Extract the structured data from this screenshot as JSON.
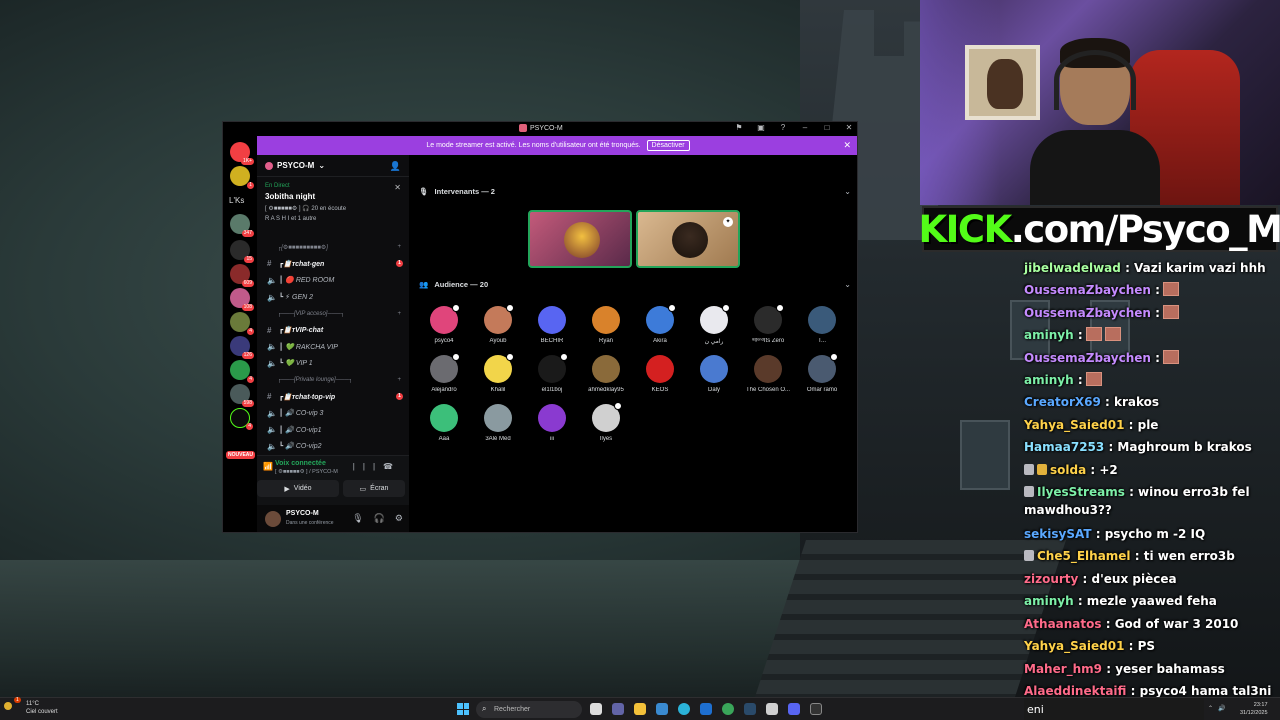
{
  "discord": {
    "title": "PSYCO-M",
    "streamer_banner": {
      "text": "Le mode streamer est activé. Les noms d'utilisateur ont été tronqués.",
      "button": "Désactiver"
    },
    "rail": {
      "lks_label": "L'Ks",
      "badges": [
        "1K+",
        "1",
        "347",
        "15",
        "609",
        "108",
        "4",
        "126",
        "4",
        "598",
        "4"
      ],
      "nouveau": "NOUVEAU"
    },
    "guild_name": "PSYCO-M",
    "live": {
      "tag": "En Direct",
      "title": "3obitha night",
      "listeners": "[ ⚙■■■■■⚙ ]  🎧 20 en écoute",
      "speakers": "R A S H I et 1 autre"
    },
    "channels": [
      {
        "kind": "cat",
        "label": "┌[⚙■■■■■■■■■⚙]"
      },
      {
        "kind": "text",
        "label": "┏📋ᴛchat-gen",
        "unread": "1"
      },
      {
        "kind": "voice",
        "label": "┃ 🔴 RED ROOM"
      },
      {
        "kind": "voice",
        "label": "┗ ⚡ GEN 2"
      },
      {
        "kind": "cat",
        "label": "┌───[VIP acceso]───┐"
      },
      {
        "kind": "text",
        "label": "┏📋ᴛVIP-chat"
      },
      {
        "kind": "voice",
        "label": "┃ 💚 RAKCHA VIP"
      },
      {
        "kind": "voice",
        "label": "┗ 💚 VIP 1"
      },
      {
        "kind": "cat",
        "label": "┌───[Private lounge]───┐"
      },
      {
        "kind": "text",
        "label": "┏📋ᴛchat-top-vip",
        "unread": "1"
      },
      {
        "kind": "voice",
        "label": "┃ 🔊 CO-vip 3"
      },
      {
        "kind": "voice",
        "label": "┃ 🔊 CO-vip1"
      },
      {
        "kind": "voice",
        "label": "┗ 🔊 CO-vip2"
      }
    ],
    "voice": {
      "status": "Voix connectée",
      "sub": "[ ⚙■■■■■⚙ ] / PSYCO-M",
      "video_btn": "Vidéo",
      "screen_btn": "Écran"
    },
    "user": {
      "name": "PSYCO-M",
      "status": "Dans une conférence"
    },
    "stage": {
      "speakers_header": "Intervenants — 2",
      "audience_header": "Audience — 20",
      "audience": [
        {
          "name": "psyco4",
          "color": "#e0457b"
        },
        {
          "name": "Ayoub",
          "color": "#c47a5a"
        },
        {
          "name": "BECHIR",
          "color": "#5865f2"
        },
        {
          "name": "Ryan",
          "color": "#d9822b"
        },
        {
          "name": "Akira",
          "color": "#3d7bd9"
        },
        {
          "name": "رامي ن",
          "color": "#e9e9ee"
        },
        {
          "name": "ˡᵉᵍᵉⁿᵈIts Zero",
          "color": "#2b2b2b"
        },
        {
          "name": "T...",
          "color": "#3a5a7a"
        },
        {
          "name": "Alejandro",
          "color": "#6b6b70"
        },
        {
          "name": "Khalil",
          "color": "#f2d54a"
        },
        {
          "name": "el1l1boj",
          "color": "#1a1a1a"
        },
        {
          "name": "ahmedklay95",
          "color": "#8a6a3a"
        },
        {
          "name": "KEOS",
          "color": "#d42020"
        },
        {
          "name": "Daly",
          "color": "#4a7ad0"
        },
        {
          "name": "The Chosen O...",
          "color": "#5a3a2a"
        },
        {
          "name": "Omar ramo",
          "color": "#4a5a70"
        },
        {
          "name": "Aaa",
          "color": "#3cbf7a"
        },
        {
          "name": "3Alé Med",
          "color": "#8a9aa0"
        },
        {
          "name": "iii",
          "color": "#8a3ad0"
        },
        {
          "name": "Ilyes",
          "color": "#d0d0d0"
        }
      ]
    }
  },
  "kick": {
    "logo": "KICK",
    "rest": ".com/Psyco_M"
  },
  "chat": [
    {
      "user": "jibelwadelwad",
      "color": "#a8ffa0",
      "text": ": Vazi karim vazi hhh"
    },
    {
      "user": "OussemaZbaychen",
      "color": "#c58bff",
      "text": ":",
      "emotes": 1
    },
    {
      "user": "OussemaZbaychen",
      "color": "#c58bff",
      "text": ":",
      "emotes": 1
    },
    {
      "user": "aminyh",
      "color": "#7df0a8",
      "text": ":",
      "emotes": 2
    },
    {
      "user": "OussemaZbaychen",
      "color": "#c58bff",
      "text": ":",
      "emotes": 1
    },
    {
      "user": "aminyh",
      "color": "#7df0a8",
      "text": ":",
      "emotes": 1
    },
    {
      "user": "CreatorX69",
      "color": "#5aa8ff",
      "text": ": krakos"
    },
    {
      "user": "Yahya_Saied01",
      "color": "#ffd24a",
      "text": ": ple"
    },
    {
      "user": "Hamaa7253",
      "color": "#8ae0ff",
      "text": ": Maghroum b krakos"
    },
    {
      "user": "solda",
      "color": "#ffd24a",
      "text": ": +2",
      "badges": [
        "silver",
        "gold"
      ]
    },
    {
      "user": "IlyesStreams",
      "color": "#7df0a8",
      "text": ": winou erro3b fel mawdhou3??",
      "badges": [
        "silver"
      ],
      "wrap": true
    },
    {
      "user": "sekisySAT",
      "color": "#5aa8ff",
      "text": ": psycho m -2 IQ"
    },
    {
      "user": "Che5_Elhamel",
      "color": "#ffd24a",
      "text": ": ti wen erro3b",
      "badges": [
        "silver"
      ]
    },
    {
      "user": "zizourty",
      "color": "#ff6b8a",
      "text": ": d'eux piècea"
    },
    {
      "user": "aminyh",
      "color": "#7df0a8",
      "text": ": mezle yaawed feha"
    },
    {
      "user": "Athaanatos",
      "color": "#ff6b8a",
      "text": ": God of war 3 2010"
    },
    {
      "user": "Yahya_Saied01",
      "color": "#ffd24a",
      "text": ": PS"
    },
    {
      "user": "Maher_hm9",
      "color": "#ff6b8a",
      "text": ": yeser bahamass"
    },
    {
      "user": "Alaeddinektaifi",
      "color": "#ff6b8a",
      "text": ": psyco4 hama tal3ni"
    }
  ],
  "taskbar": {
    "weather_temp": "11°C",
    "weather_desc": "Ciel couvert",
    "weather_badge": "1",
    "search_placeholder": "Rechercher",
    "chat_input": "eni",
    "time": "23:17",
    "date": "31/12/2025"
  }
}
